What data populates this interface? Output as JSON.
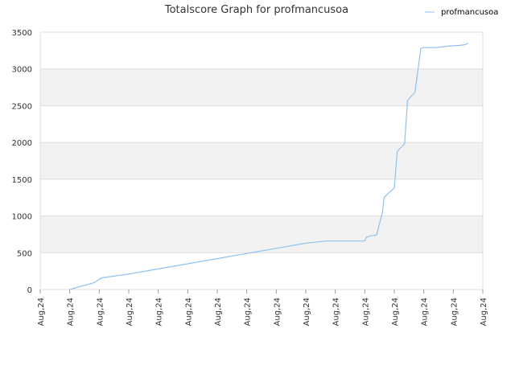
{
  "chart_data": {
    "type": "line",
    "title": "Totalscore Graph for profmancusoa",
    "xlabel": "",
    "ylabel": "",
    "x_tick_labels": [
      "Aug,24",
      "Aug,24",
      "Aug,24",
      "Aug,24",
      "Aug,24",
      "Aug,24",
      "Aug,24",
      "Aug,24",
      "Aug,24",
      "Aug,24",
      "Aug,24",
      "Aug,24",
      "Aug,24",
      "Aug,24",
      "Aug,24",
      "Aug,24"
    ],
    "ylim": [
      0,
      3500
    ],
    "y_ticks": [
      0,
      500,
      1000,
      1500,
      2000,
      2500,
      3000,
      3500
    ],
    "grid": "horizontal alternating bands",
    "legend_position": "top-right",
    "colors": {
      "line": "#8fc0ee",
      "band": "#f2f2f2",
      "grid": "#dddddd"
    },
    "series": [
      {
        "name": "profmancusoa",
        "x": [
          1.0,
          1.8,
          1.9,
          2.0,
          2.1,
          3.0,
          4.0,
          5.0,
          6.0,
          7.0,
          8.0,
          9.0,
          9.7,
          10.0,
          11.0,
          11.05,
          11.2,
          11.4,
          11.5,
          11.6,
          11.65,
          11.7,
          11.8,
          12.0,
          12.1,
          12.2,
          12.35,
          12.45,
          12.55,
          12.7,
          12.9,
          13.0,
          13.05,
          13.1,
          13.4,
          13.8,
          14.2,
          14.4,
          14.5
        ],
        "y": [
          0,
          90,
          110,
          140,
          160,
          210,
          280,
          350,
          420,
          490,
          560,
          630,
          660,
          660,
          660,
          710,
          730,
          740,
          900,
          1050,
          1250,
          1270,
          1310,
          1380,
          1880,
          1920,
          1980,
          2570,
          2620,
          2680,
          3280,
          3290,
          3290,
          3290,
          3290,
          3310,
          3320,
          3330,
          3350
        ]
      }
    ]
  }
}
